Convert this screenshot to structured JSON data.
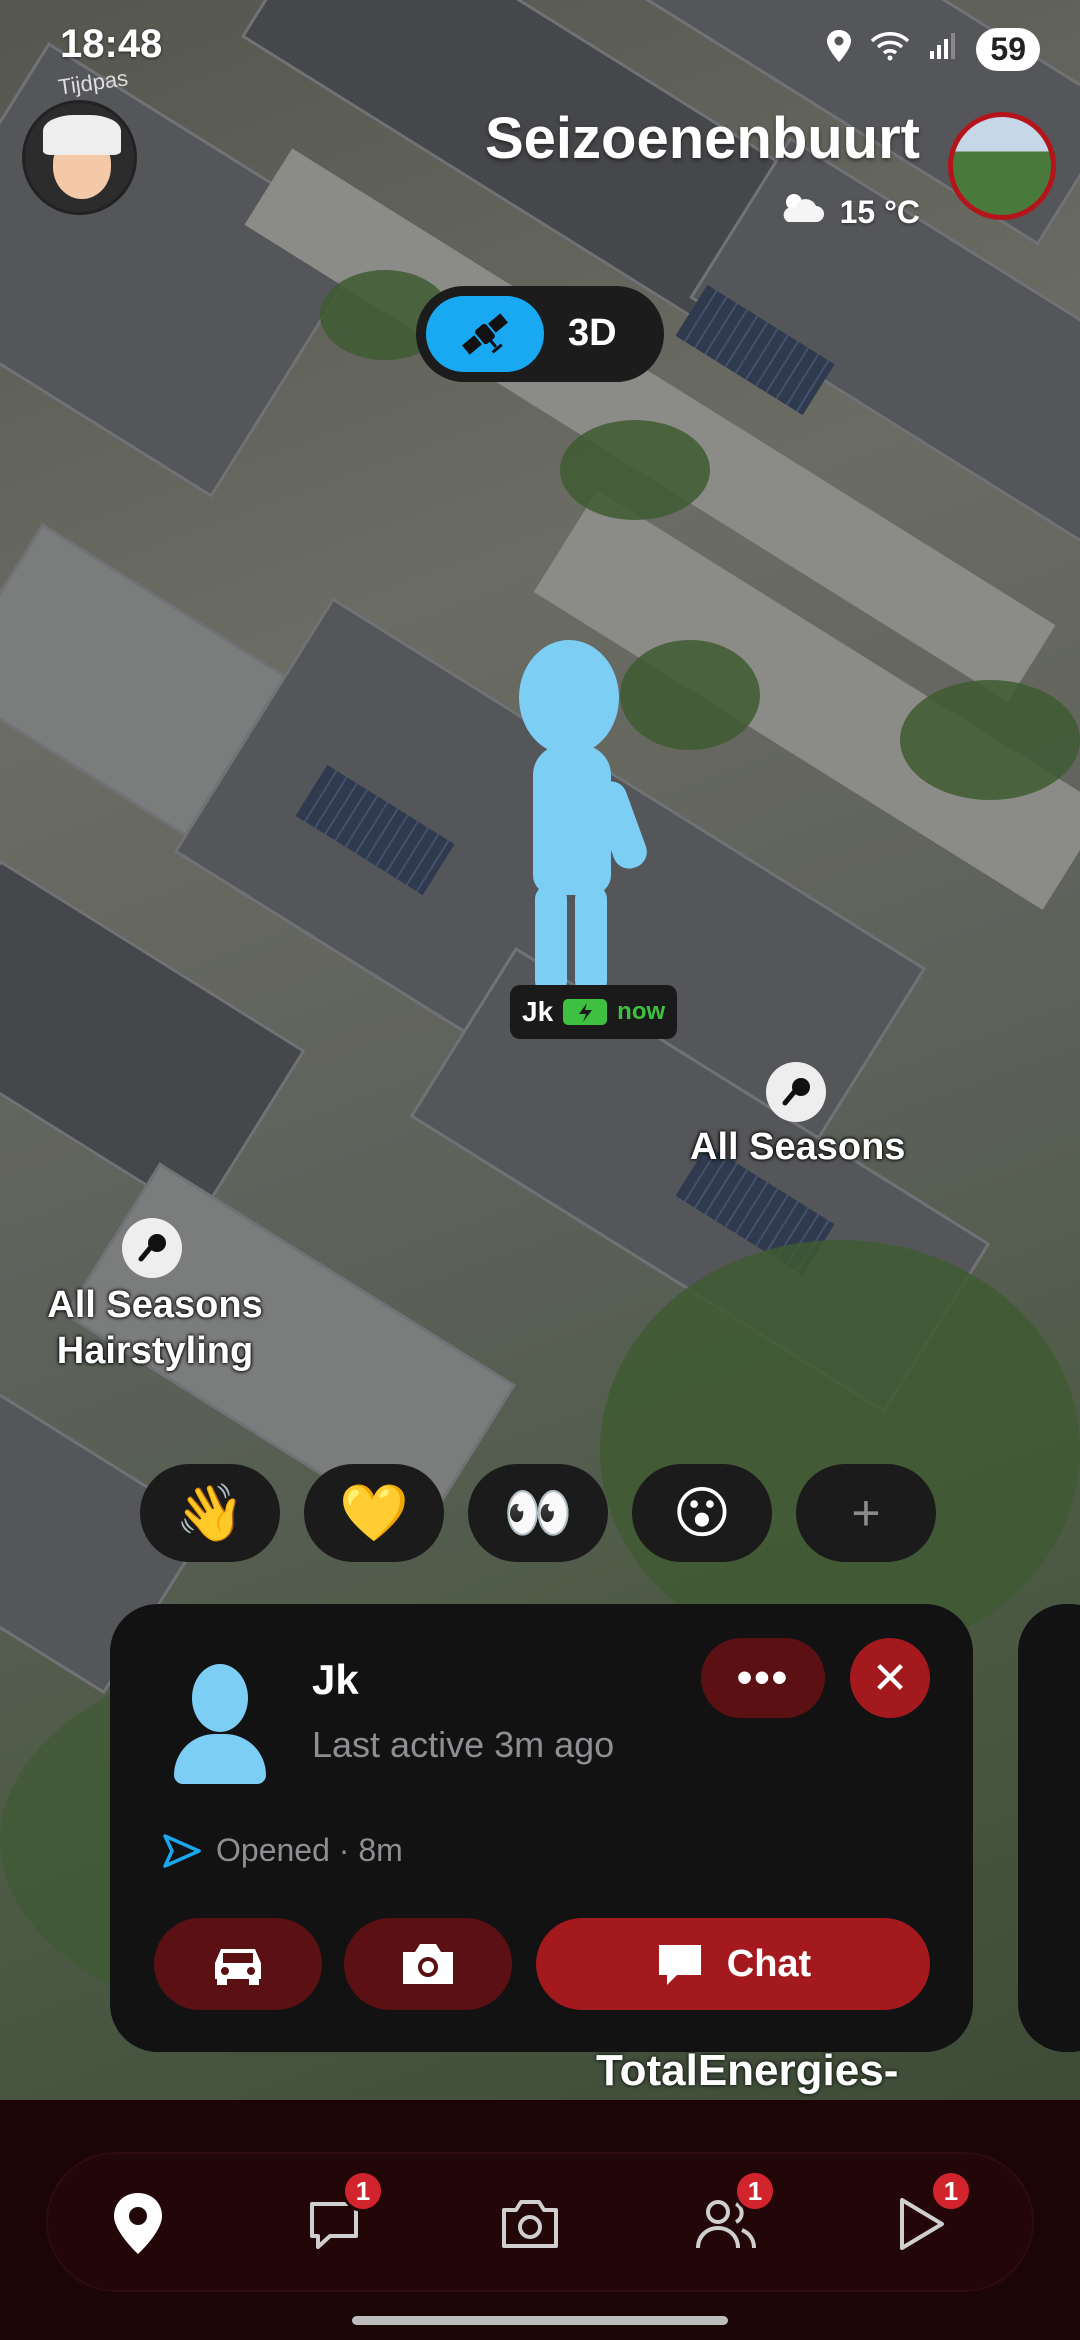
{
  "status_bar": {
    "time": "18:48",
    "battery": "59"
  },
  "map_watermark": "Tijdpas",
  "header": {
    "place": "Seizoenenbuurt",
    "temperature": "15 °C"
  },
  "mode_toggle": {
    "view_3d_label": "3D"
  },
  "friend_marker": {
    "name": "Jk",
    "status": "now"
  },
  "pois": [
    {
      "label": "All Seasons"
    },
    {
      "label_line1": "All Seasons",
      "label_line2": "Hairstyling"
    },
    {
      "label": "TotalEnergies-"
    }
  ],
  "reactions": [
    "👋",
    "💛",
    "👀",
    "😮",
    "+"
  ],
  "friend_card": {
    "name": "Jk",
    "last_active": "Last active 3m ago",
    "opened": "Opened · 8m",
    "more_label": "•••",
    "close_label": "✕",
    "chat_label": "Chat"
  },
  "bottom_nav": {
    "items": [
      {
        "name": "map",
        "badge": ""
      },
      {
        "name": "chat",
        "badge": "1"
      },
      {
        "name": "camera",
        "badge": ""
      },
      {
        "name": "friends",
        "badge": "1"
      },
      {
        "name": "stories",
        "badge": "1"
      }
    ]
  },
  "colors": {
    "accent_blue": "#19a9f3",
    "snap_red": "#a3191e",
    "dark_red": "#5b1013",
    "online_green": "#3ec140"
  }
}
